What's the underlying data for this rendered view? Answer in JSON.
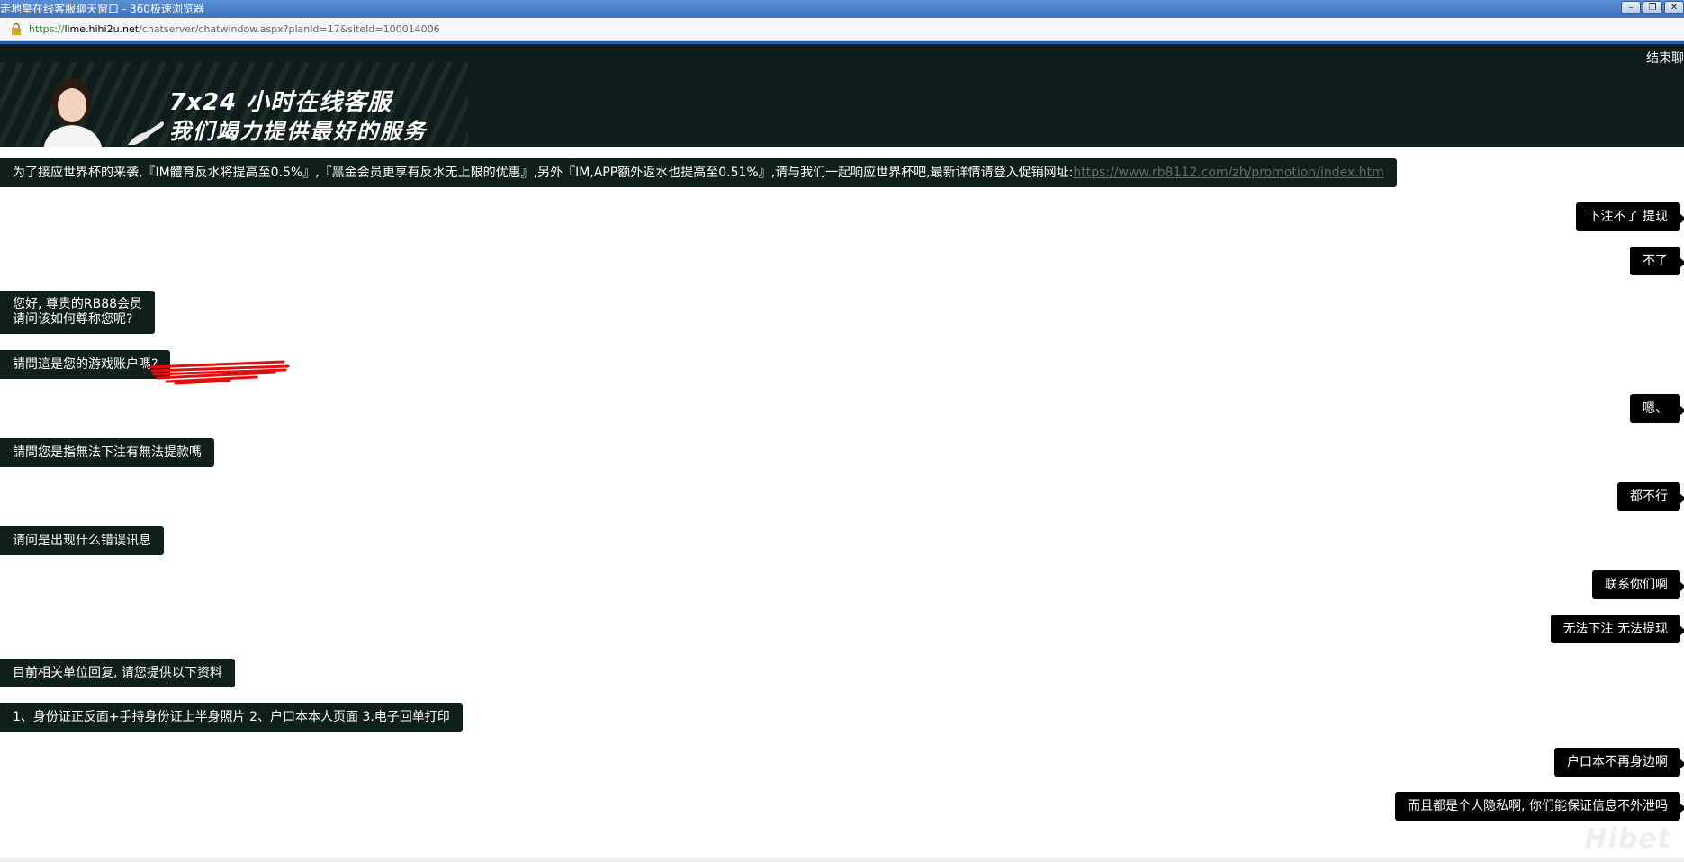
{
  "window": {
    "title": "走地皇在线客服聊天窗口 - 360极速浏览器",
    "buttons": [
      "minimize",
      "restore",
      "close"
    ]
  },
  "address_bar": {
    "scheme": "https://",
    "host": "lime.hihi2u.net",
    "path": "/chatserver/chatwindow.aspx?planId=17&siteId=100014006"
  },
  "banner": {
    "line1": "7x24 小时在线客服",
    "line2": "我们竭力提供最好的服务",
    "end_chat": "结束聊"
  },
  "messages": [
    {
      "side": "left",
      "text": "为了接应世界杯的来袭,『IM體育反水将提高至0.5%』,『黑金会员更享有反水无上限的优惠』,另外『IM,APP额外返水也提高至0.51%』,请与我们一起响应世界杯吧,最新详情请登入促销网址:",
      "link": "https://www.rb8112.com/zh/promotion/index.htm"
    },
    {
      "side": "right",
      "text": "下注不了 提现"
    },
    {
      "side": "right",
      "text": "不了"
    },
    {
      "side": "left",
      "text": "您好, 尊贵的RB88会员",
      "text2": "请问该如何尊称您呢?"
    },
    {
      "side": "left",
      "text": "請問這是您的游戏账户嗎?"
    },
    {
      "side": "right",
      "text": "嗯、"
    },
    {
      "side": "left",
      "text": "請問您是指無法下注有無法提款嗎"
    },
    {
      "side": "right",
      "text": "都不行"
    },
    {
      "side": "left",
      "text": "请问是出现什么错误讯息"
    },
    {
      "side": "right",
      "text": "联系你们啊"
    },
    {
      "side": "right",
      "text": "无法下注 无法提现"
    },
    {
      "side": "left",
      "text": "目前相关单位回复, 请您提供以下资料"
    },
    {
      "side": "left",
      "text": "1、身份证正反面+手持身份证上半身照片 2、户口本本人页面 3.电子回单打印"
    },
    {
      "side": "right",
      "text": "户口本不再身边啊"
    },
    {
      "side": "right",
      "text": "而且都是个人隐私啊, 你们能保证信息不外泄吗"
    }
  ],
  "watermark": "Hibet",
  "colors": {
    "banner_bg": "#0e1d1b",
    "left_bubble": "#0e1f1c",
    "right_bubble": "#000000",
    "redaction": "#e01010"
  }
}
